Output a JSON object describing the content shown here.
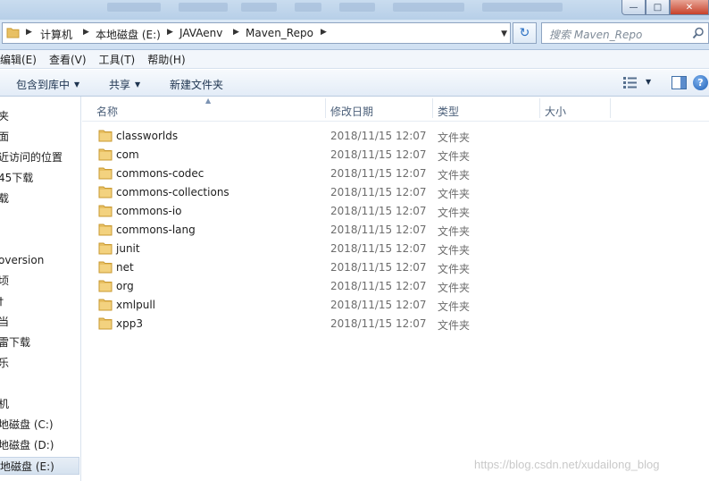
{
  "window": {
    "minimize_glyph": "—",
    "maximize_glyph": "□",
    "close_glyph": "✕"
  },
  "address": {
    "crumbs": [
      "计算机",
      "本地磁盘 (E:)",
      "JAVAenv",
      "Maven_Repo"
    ],
    "search_placeholder": "搜索 Maven_Repo",
    "refresh_glyph": "↻"
  },
  "menu": {
    "items": [
      "编辑(E)",
      "查看(V)",
      "工具(T)",
      "帮助(H)"
    ]
  },
  "commands": {
    "include_library": "包含到库中",
    "share": "共享",
    "new_folder": "新建文件夹",
    "help_glyph": "?"
  },
  "nav": {
    "items": [
      "夹",
      "面",
      "近访问的位置",
      "45下载",
      "载",
      "oversion",
      "顷",
      "†",
      "当",
      "雷下载",
      "乐",
      "机",
      "地磁盘 (C:)",
      "地磁盘 (D:)",
      "地磁盘 (E:)"
    ]
  },
  "columns": {
    "name": "名称",
    "modified": "修改日期",
    "type": "类型",
    "size": "大小"
  },
  "files": [
    {
      "name": "classworlds",
      "modified": "2018/11/15 12:07",
      "type": "文件夹"
    },
    {
      "name": "com",
      "modified": "2018/11/15 12:07",
      "type": "文件夹"
    },
    {
      "name": "commons-codec",
      "modified": "2018/11/15 12:07",
      "type": "文件夹"
    },
    {
      "name": "commons-collections",
      "modified": "2018/11/15 12:07",
      "type": "文件夹"
    },
    {
      "name": "commons-io",
      "modified": "2018/11/15 12:07",
      "type": "文件夹"
    },
    {
      "name": "commons-lang",
      "modified": "2018/11/15 12:07",
      "type": "文件夹"
    },
    {
      "name": "junit",
      "modified": "2018/11/15 12:07",
      "type": "文件夹"
    },
    {
      "name": "net",
      "modified": "2018/11/15 12:07",
      "type": "文件夹"
    },
    {
      "name": "org",
      "modified": "2018/11/15 12:07",
      "type": "文件夹"
    },
    {
      "name": "xmlpull",
      "modified": "2018/11/15 12:07",
      "type": "文件夹"
    },
    {
      "name": "xpp3",
      "modified": "2018/11/15 12:07",
      "type": "文件夹"
    }
  ],
  "watermark": "https://blog.csdn.net/xudailong_blog",
  "colors": {
    "folder": "#e8c063",
    "folder_dark": "#c99a32",
    "accent": "#2a6fc2"
  }
}
